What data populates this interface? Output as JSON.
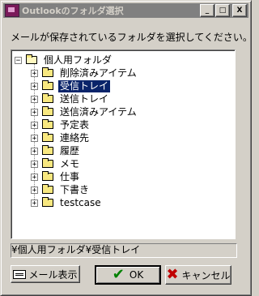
{
  "window": {
    "title": "Outlookのフォルダ選択",
    "minimize_label": "_",
    "maximize_label": "□",
    "close_label": "X"
  },
  "prompt": "メールが保存されているフォルダを選択してください。",
  "tree": {
    "root": {
      "expander": "−",
      "label": "個人用フォルダ"
    },
    "children": [
      {
        "expander": "+",
        "label": "削除済みアイテム"
      },
      {
        "expander": "+",
        "label": "受信トレイ",
        "selected": true
      },
      {
        "expander": "+",
        "label": "送信トレイ"
      },
      {
        "expander": "+",
        "label": "送信済みアイテム"
      },
      {
        "expander": "+",
        "label": "予定表"
      },
      {
        "expander": "+",
        "label": "連絡先"
      },
      {
        "expander": "+",
        "label": "履歴"
      },
      {
        "expander": "+",
        "label": "メモ"
      },
      {
        "expander": "+",
        "label": "仕事"
      },
      {
        "expander": "+",
        "label": "下書き"
      },
      {
        "expander": "+",
        "label": "testcase"
      }
    ]
  },
  "status_path": "¥個人用フォルダ¥受信トレイ",
  "buttons": {
    "mail_view": "メール表示",
    "ok": "OK",
    "cancel": "キャンセル"
  },
  "icons": {
    "app": "outlook-app-icon",
    "folder": "folder-icon",
    "mail_view": "mail-icon",
    "ok": "checkmark-icon",
    "cancel": "x-icon"
  }
}
